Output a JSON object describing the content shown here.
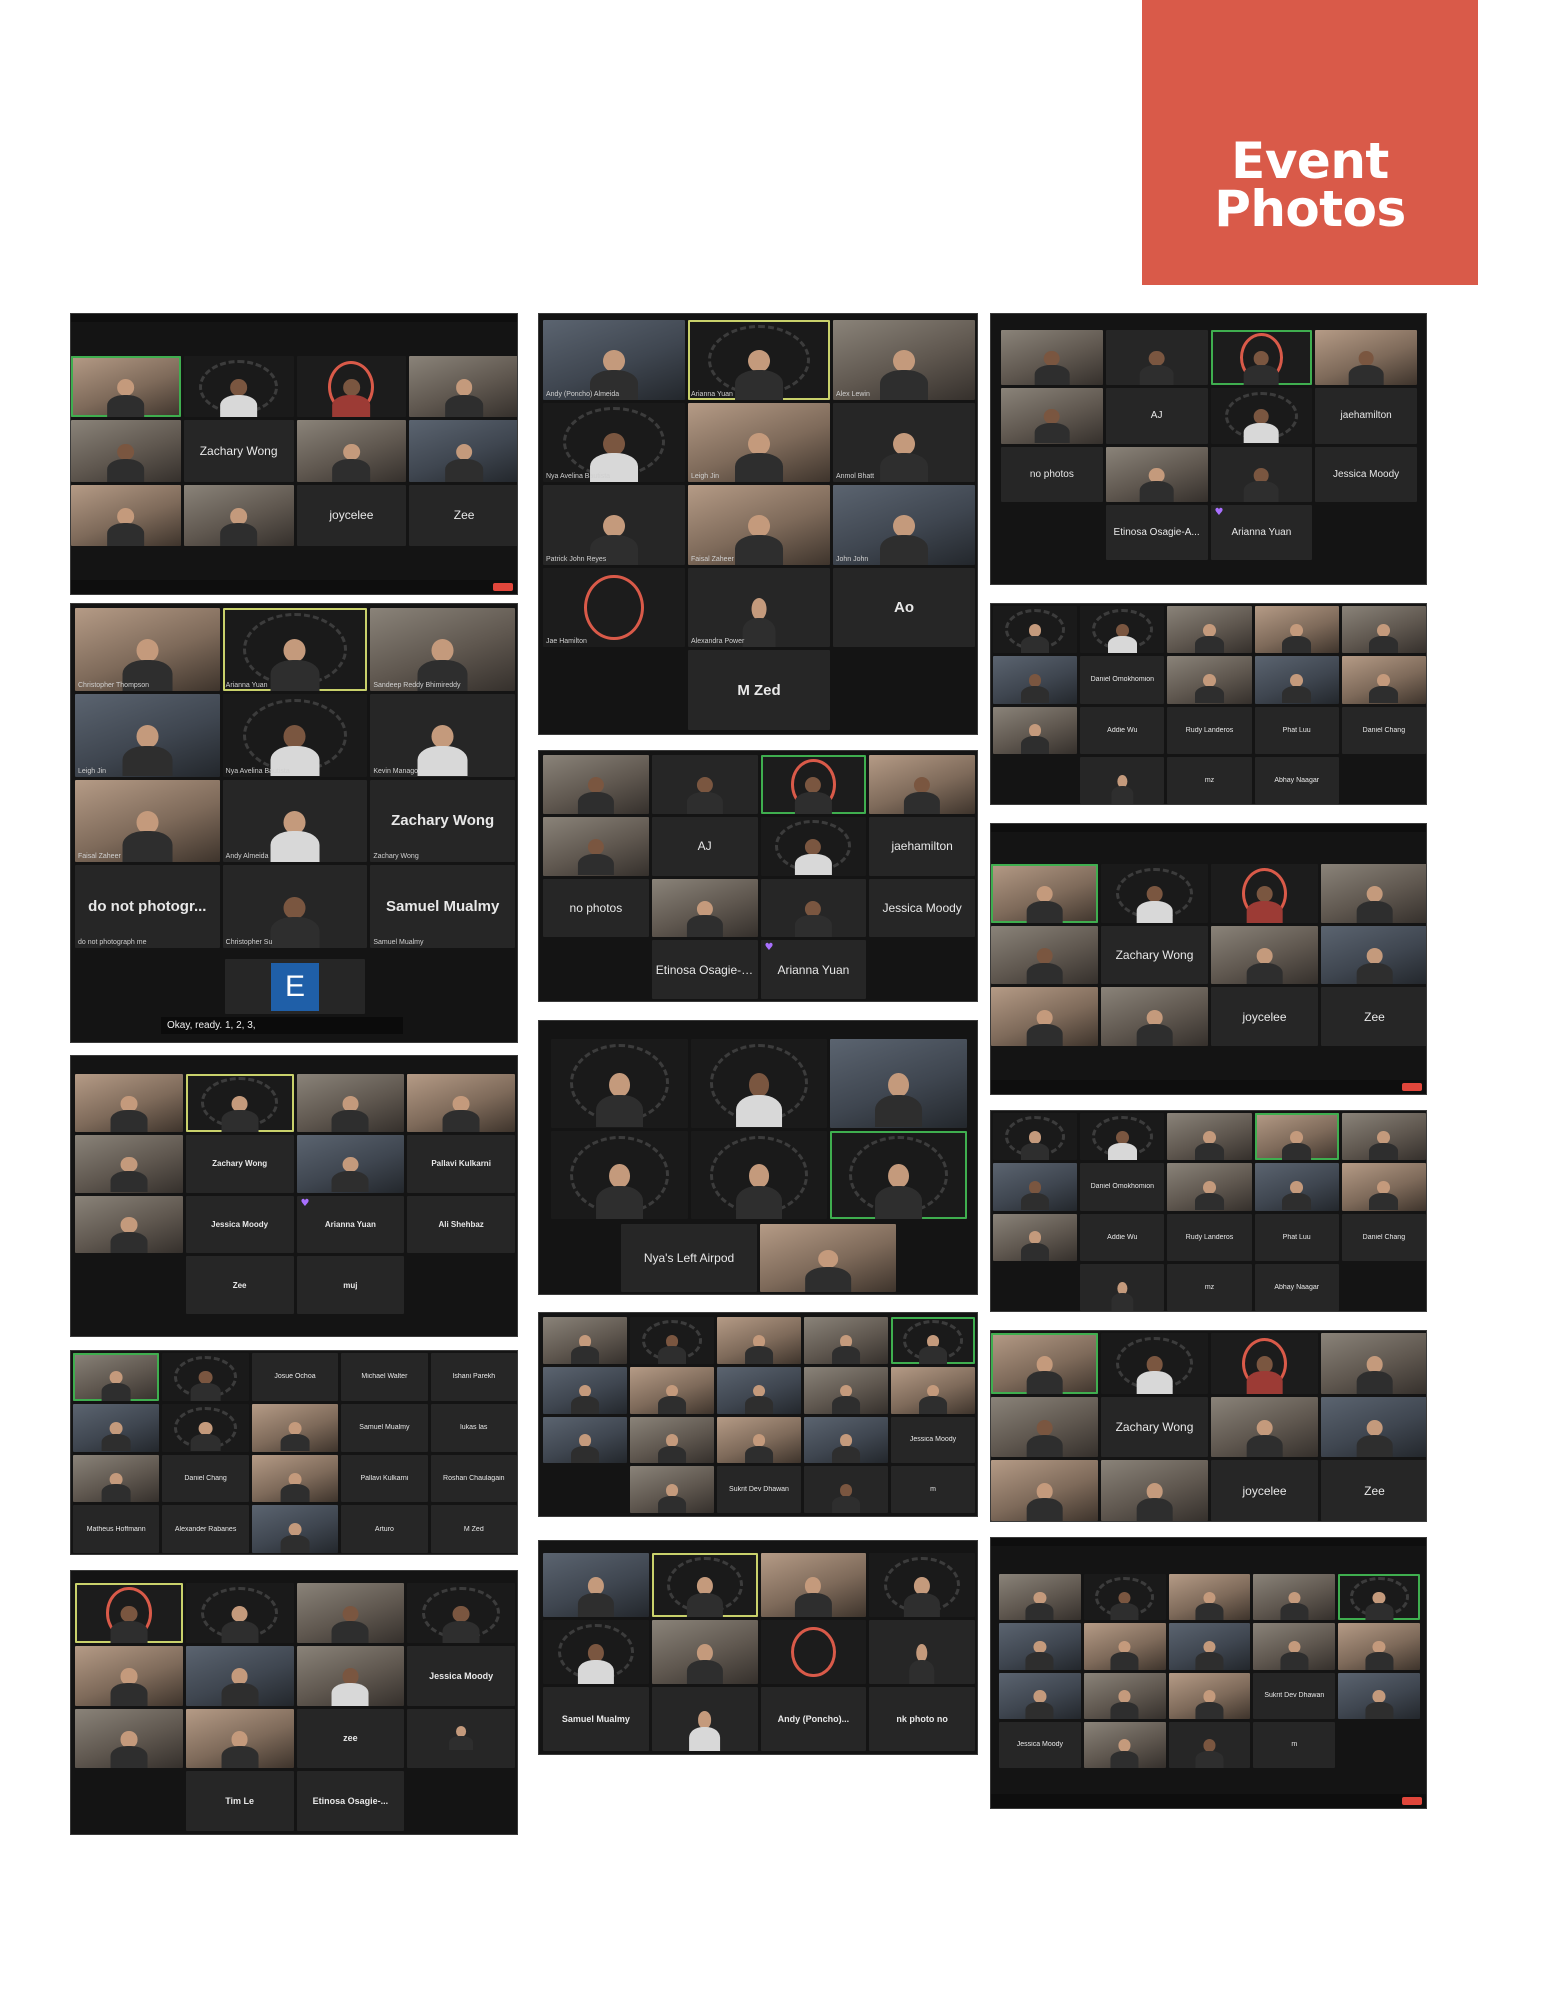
{
  "banner": {
    "title": "Event Photos",
    "color": "#d95a49"
  },
  "shots": {
    "s1": {
      "tiles": [
        "",
        "",
        "",
        "",
        "",
        "Zachary Wong",
        "",
        "",
        "",
        "",
        "joycelee",
        "Zee"
      ]
    },
    "s2": {
      "tiles": [
        "Christopher Thompson",
        "Arianna Yuan",
        "Sandeep Reddy Bhimireddy",
        "Leigh Jin",
        "Nya Avelina Bautista",
        "Kevin Manago",
        "Faisal Zaheer",
        "Andy Almeida",
        "Zachary Wong",
        "do not photogr...",
        "Christopher Su",
        "Samuel Mualmy",
        "E"
      ],
      "captions": [
        "Christopher Thompson",
        "Arianna Yuan",
        "Sandeep Reddy Bhimireddy",
        "Leigh Jin",
        "Nya Avelina Bautista",
        "Kevin Manago",
        "Faisal Zaheer",
        "Andy Almeida",
        "Zachary Wong",
        "do not photograph me",
        "Christopher Su",
        "Samuel Mualmy"
      ],
      "subtitle": "Okay, ready. 1, 2, 3,"
    },
    "s3": {
      "tiles": [
        "",
        "",
        "",
        "",
        "",
        "Zachary Wong",
        "",
        "Pallavi Kulkarni",
        "",
        "Jessica Moody",
        "Arianna Yuan",
        "Ali Shehbaz",
        "Zee",
        "muj"
      ]
    },
    "s4": {
      "tiles": [
        "",
        "",
        "Josue Ochoa",
        "Michael Walter",
        "Ishani Parekh",
        "",
        "",
        "",
        "Samuel Mualmy",
        "lukas las",
        "",
        "Daniel Chang",
        "",
        "Pallavi Kulkarni",
        "Roshan Chaulagain",
        "Matheus Hoffmann",
        "Alexander Rabanes",
        "",
        "Arturo",
        "M Zed"
      ]
    },
    "s5": {
      "tiles": [
        "",
        "",
        "",
        "",
        "",
        "",
        "",
        "",
        "",
        "Jessica Moody",
        "",
        "",
        "",
        "zee",
        "",
        "",
        "",
        "Tim Le",
        "Etinosa Osagie-...",
        ""
      ]
    },
    "s6": {
      "tiles": [
        "Andy (Poncho) Almeida",
        "Arianna Yuan",
        "Alex Lewin",
        "Nya Avelina Bautista",
        "Leigh Jin",
        "Anmol Bhatt",
        "Patrick John Reyes",
        "Faisal Zaheer",
        "John John",
        "Jae Hamilton",
        "Alexandra Power",
        "Ao",
        "M Zed"
      ]
    },
    "s7": {
      "tiles": [
        "",
        "",
        "",
        "",
        "",
        "AJ",
        "",
        "jaehamilton",
        "no photos",
        "",
        "",
        "Jessica Moody",
        "",
        "Etinosa Osagie-A...",
        "Arianna Yuan",
        ""
      ]
    },
    "s8": {
      "tiles": [
        "",
        "",
        "",
        "",
        "",
        "",
        "Nya's Left Airpod",
        ""
      ]
    },
    "s9": {
      "tiles": [
        "",
        "",
        "",
        "",
        "",
        "",
        "",
        "",
        "",
        "",
        "",
        "",
        "",
        "",
        "Jessica Moody",
        "",
        "Sukrit Dev Dhawan",
        "",
        "m"
      ]
    },
    "s10": {
      "tiles": [
        "",
        "",
        "",
        "",
        "",
        "",
        "",
        "",
        "",
        "Samuel Mualmy",
        "",
        "Andy (Poncho)...",
        "nk photo no"
      ]
    },
    "s11": {
      "tiles": [
        "",
        "",
        "",
        "",
        "",
        "AJ",
        "",
        "jaehamilton",
        "no photos",
        "",
        "",
        "Jessica Moody",
        "Etinosa Osagie-A...",
        "Arianna Yuan"
      ]
    },
    "s12": {
      "tiles": [
        "",
        "",
        "",
        "",
        "",
        "",
        "Daniel Omokhomion",
        "",
        "",
        "",
        "",
        "Addie Wu",
        "Rudy Landeros",
        "Phat Luu",
        "Daniel Chang",
        "mz",
        "Abhay Naagar"
      ]
    },
    "s13": {
      "tiles": [
        "",
        "",
        "",
        "",
        "",
        "Zachary Wong",
        "",
        "",
        "",
        "",
        "joycelee",
        "Zee"
      ]
    },
    "s14": {
      "tiles": [
        "",
        "",
        "",
        "",
        "",
        "",
        "Daniel Omokhomion",
        "",
        "",
        "",
        "",
        "Addie Wu",
        "Rudy Landeros",
        "Phat Luu",
        "Daniel Chang",
        "mz",
        "Abhay Naagar"
      ]
    },
    "s15": {
      "tiles": [
        "",
        "",
        "",
        "",
        "",
        "Zachary Wong",
        "",
        "",
        "",
        "",
        "joycelee",
        "Zee"
      ]
    },
    "s16": {
      "tiles": [
        "",
        "",
        "",
        "",
        "",
        "",
        "",
        "",
        "",
        "",
        "",
        "",
        "",
        "Sukrit Dev Dhawan",
        "",
        "Jessica Moody",
        "",
        "",
        "m"
      ]
    }
  }
}
